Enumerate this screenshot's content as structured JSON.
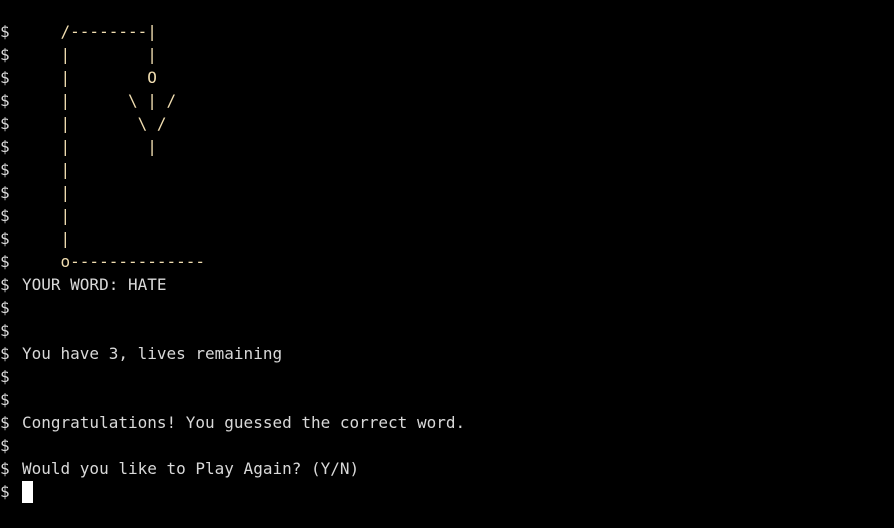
{
  "terminal": {
    "prompt": "$",
    "lines": [
      {
        "text": "    /--------|",
        "kind": "art"
      },
      {
        "text": "    |        |",
        "kind": "art"
      },
      {
        "text": "    |        O",
        "kind": "art"
      },
      {
        "text": "    |      \\ | /",
        "kind": "art"
      },
      {
        "text": "    |       \\ /",
        "kind": "art"
      },
      {
        "text": "    |        |",
        "kind": "art"
      },
      {
        "text": "    |",
        "kind": "art"
      },
      {
        "text": "    |",
        "kind": "art"
      },
      {
        "text": "    |",
        "kind": "art"
      },
      {
        "text": "    |",
        "kind": "art"
      },
      {
        "text": "    o--------------",
        "kind": "art"
      },
      {
        "text": "YOUR WORD: HATE",
        "kind": "text"
      },
      {
        "text": "",
        "kind": "text"
      },
      {
        "text": "",
        "kind": "text"
      },
      {
        "text": "You have 3, lives remaining",
        "kind": "text"
      },
      {
        "text": "",
        "kind": "text"
      },
      {
        "text": "",
        "kind": "text"
      },
      {
        "text": "Congratulations! You guessed the correct word.",
        "kind": "text"
      },
      {
        "text": "",
        "kind": "text"
      },
      {
        "text": "Would you like to Play Again? (Y/N)",
        "kind": "text"
      }
    ],
    "input_line": ""
  },
  "colors": {
    "background": "#000000",
    "text": "#d9d9d9",
    "art": "#f0ddb0",
    "cursor": "#ffffff"
  }
}
